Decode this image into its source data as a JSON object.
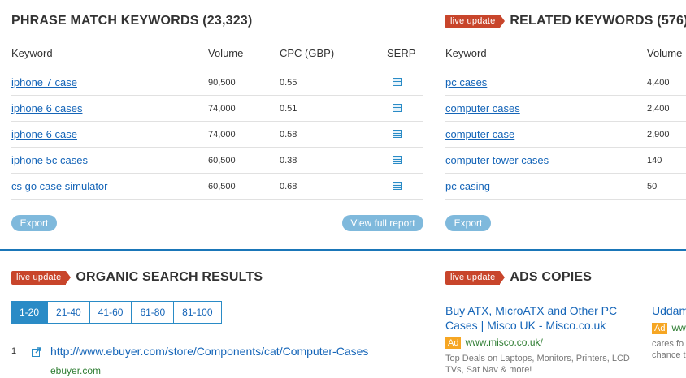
{
  "phrase": {
    "title": "PHRASE MATCH KEYWORDS (23,323)",
    "headers": {
      "keyword": "Keyword",
      "volume": "Volume",
      "cpc": "CPC (GBP)",
      "serp": "SERP"
    },
    "rows": [
      {
        "keyword": "iphone 7 case",
        "volume": "90,500",
        "cpc": "0.55"
      },
      {
        "keyword": "iphone 6 cases",
        "volume": "74,000",
        "cpc": "0.51"
      },
      {
        "keyword": "iphone 6 case",
        "volume": "74,000",
        "cpc": "0.58"
      },
      {
        "keyword": "iphone 5c cases",
        "volume": "60,500",
        "cpc": "0.38"
      },
      {
        "keyword": "cs go case simulator",
        "volume": "60,500",
        "cpc": "0.68"
      }
    ],
    "export_label": "Export",
    "full_report_label": "View full report"
  },
  "related": {
    "badge": "live update",
    "title": "RELATED KEYWORDS (576)",
    "headers": {
      "keyword": "Keyword",
      "volume": "Volume"
    },
    "rows": [
      {
        "keyword": "pc cases",
        "volume": "4,400"
      },
      {
        "keyword": "computer cases",
        "volume": "2,400"
      },
      {
        "keyword": "computer case",
        "volume": "2,900"
      },
      {
        "keyword": "computer tower cases",
        "volume": "140"
      },
      {
        "keyword": "pc casing",
        "volume": "50"
      }
    ],
    "export_label": "Export"
  },
  "organic": {
    "badge": "live update",
    "title": "ORGANIC SEARCH RESULTS",
    "pages": [
      "1-20",
      "21-40",
      "41-60",
      "61-80",
      "81-100"
    ],
    "active_page": "1-20",
    "results": [
      {
        "rank": "1",
        "url": "http://www.ebuyer.com/store/Components/cat/Computer-Cases",
        "domain": "ebuyer.com"
      }
    ]
  },
  "ads": {
    "badge": "live update",
    "title": "ADS COPIES",
    "ad_label": "Ad",
    "items": [
      {
        "title": "Buy ATX, MicroATX and Other PC Cases | Misco UK - Misco.co.uk",
        "url": "www.misco.co.uk/",
        "desc": "Top Deals on Laptops, Monitors, Printers, LCD TVs, Sat Nav & more!"
      },
      {
        "title": "Uddam",
        "url": "ww",
        "desc": "cares fo chance t"
      }
    ]
  },
  "colors": {
    "accent": "#1a76b8",
    "badge": "#c8452b",
    "link": "#1565b8",
    "green": "#2e7d32",
    "ad": "#f6a623"
  }
}
